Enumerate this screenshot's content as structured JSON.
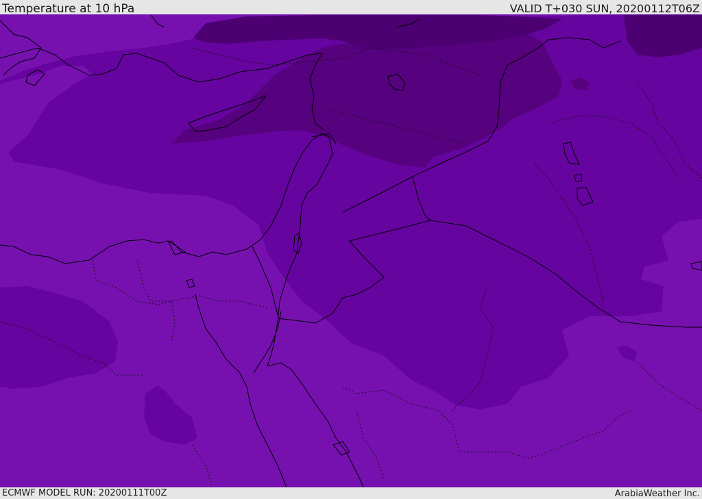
{
  "header": {
    "title": "Temperature at 10 hPa",
    "valid": "VALID T+030 SUN, 20200112T06Z"
  },
  "footer": {
    "model_run": "ECMWF MODEL RUN: 20200111T00Z",
    "credit": "ArabiaWeather Inc."
  },
  "map": {
    "colors": {
      "background_light": "#7611b0",
      "level_mid": "#66049f",
      "level_dark": "#56017e",
      "level_darkest": "#4c0071",
      "coastline": "#000000",
      "border": "#000000"
    }
  }
}
